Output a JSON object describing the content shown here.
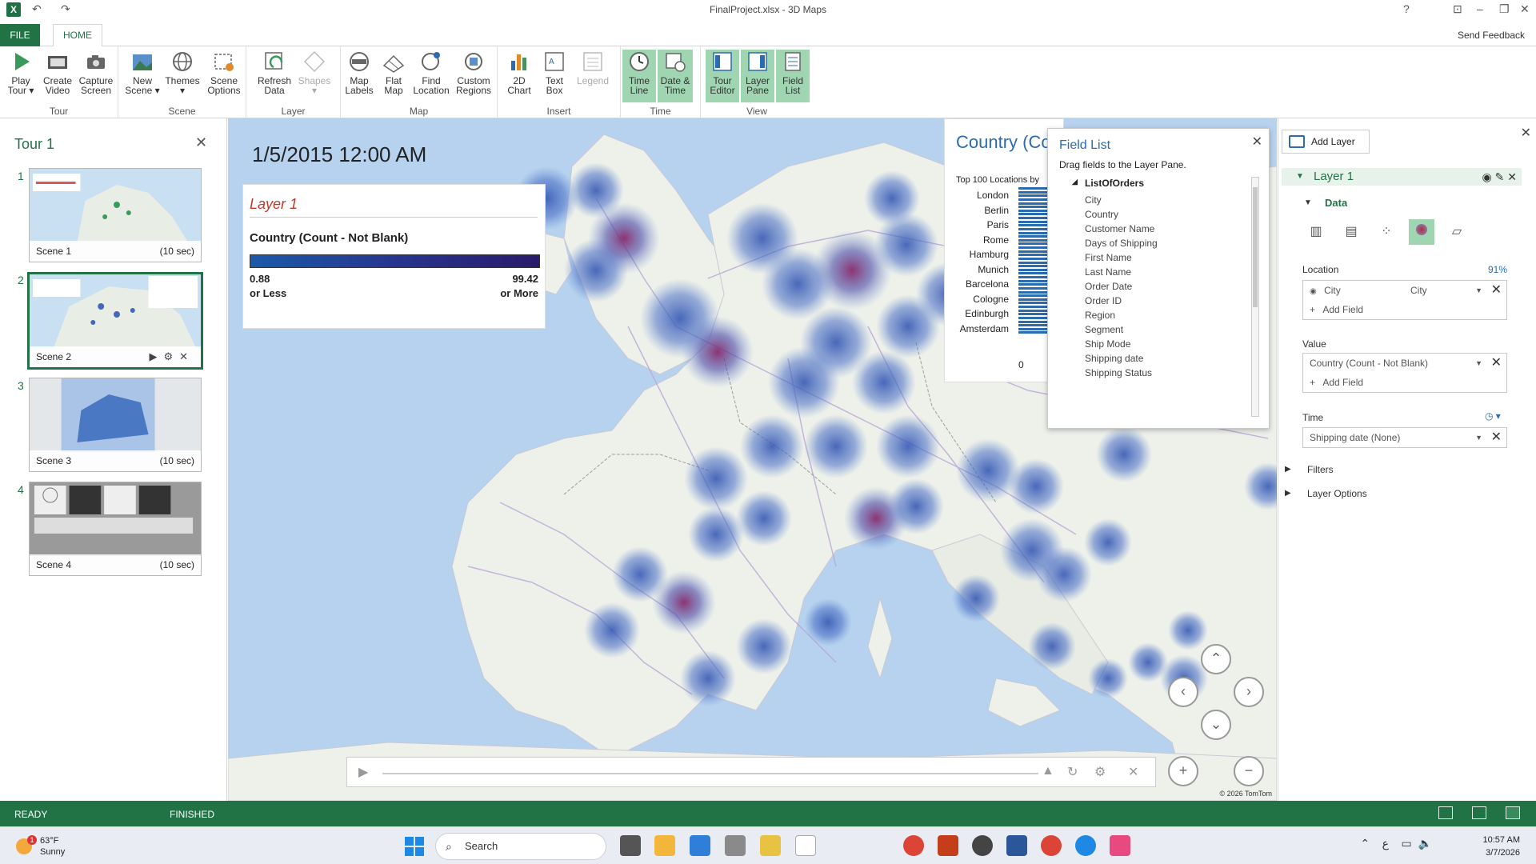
{
  "window": {
    "title": "FinalProject.xlsx - 3D Maps"
  },
  "tabs": {
    "file": "FILE",
    "home": "HOME",
    "send_feedback": "Send Feedback"
  },
  "ribbon": {
    "groups": [
      {
        "label": "Tour",
        "buttons": [
          "Play Tour",
          "Create Video",
          "Capture Screen"
        ]
      },
      {
        "label": "Scene",
        "buttons": [
          "New Scene",
          "Themes",
          "Scene Options"
        ]
      },
      {
        "label": "Layer",
        "buttons": [
          "Refresh Data",
          "Shapes"
        ]
      },
      {
        "label": "Map",
        "buttons": [
          "Map Labels",
          "Flat Map",
          "Find Location",
          "Custom Regions"
        ]
      },
      {
        "label": "Insert",
        "buttons": [
          "2D Chart",
          "Text Box",
          "Legend"
        ]
      },
      {
        "label": "Time",
        "buttons": [
          "Time Line",
          "Date & Time"
        ]
      },
      {
        "label": "View",
        "buttons": [
          "Tour Editor",
          "Layer Pane",
          "Field List"
        ]
      }
    ],
    "b": {
      "play_tour": [
        "Play",
        "Tour ▾"
      ],
      "create_video": [
        "Create",
        "Video"
      ],
      "capture_screen": [
        "Capture",
        "Screen"
      ],
      "new_scene": [
        "New",
        "Scene ▾"
      ],
      "themes": [
        "Themes",
        "▾"
      ],
      "scene_options": [
        "Scene",
        "Options"
      ],
      "refresh_data": [
        "Refresh",
        "Data"
      ],
      "shapes": [
        "Shapes",
        "▾"
      ],
      "map_labels": [
        "Map",
        "Labels"
      ],
      "flat_map": [
        "Flat",
        "Map"
      ],
      "find_location": [
        "Find",
        "Location"
      ],
      "custom_regions": [
        "Custom",
        "Regions"
      ],
      "chart_2d": [
        "2D",
        "Chart"
      ],
      "text_box": [
        "Text",
        "Box"
      ],
      "legend": [
        "Legend",
        ""
      ],
      "time_line": [
        "Time",
        "Line"
      ],
      "date_time": [
        "Date &",
        "Time"
      ],
      "tour_editor": [
        "Tour",
        "Editor"
      ],
      "layer_pane": [
        "Layer",
        "Pane"
      ],
      "field_list": [
        "Field",
        "List"
      ]
    }
  },
  "tour": {
    "title": "Tour 1",
    "scenes": [
      {
        "num": "1",
        "name": "Scene 1",
        "duration": "(10 sec)"
      },
      {
        "num": "2",
        "name": "Scene 2",
        "duration": ""
      },
      {
        "num": "3",
        "name": "Scene 3",
        "duration": "(10 sec)"
      },
      {
        "num": "4",
        "name": "Scene 4",
        "duration": "(10 sec)"
      }
    ]
  },
  "map": {
    "datetime": "1/5/2015 12:00 AM",
    "copyright": "© 2026 TomTom",
    "legend": {
      "layer": "Layer 1",
      "field": "Country (Count - Not Blank)",
      "min_value": "0.88",
      "min_label": "or Less",
      "max_value": "99.42",
      "max_label": "or More"
    },
    "top_locations": {
      "title": "Country (Co",
      "subtitle": "Top 100 Locations",
      "subtitle_cut": "by",
      "axis_zero": "0"
    }
  },
  "chart_data": {
    "type": "bar",
    "title": "Country (Co",
    "subtitle": "Top 100 Locations",
    "categories": [
      "London",
      "Berlin",
      "Paris",
      "Rome",
      "Hamburg",
      "Munich",
      "Barcelona",
      "Cologne",
      "Edinburgh",
      "Amsterdam"
    ],
    "xlabel": "0"
  },
  "field_list": {
    "title": "Field List",
    "hint": "Drag fields to the Layer Pane.",
    "group": "ListOfOrders",
    "fields": [
      "City",
      "Country",
      "Customer Name",
      "Days of Shipping",
      "First Name",
      "Last Name",
      "Order Date",
      "Order ID",
      "Region",
      "Segment",
      "Ship Mode",
      "Shipping date",
      "Shipping Status"
    ]
  },
  "layer_pane": {
    "add_layer": "Add Layer",
    "layer_name": "Layer 1",
    "data_label": "Data",
    "location_label": "Location",
    "location_pct": "91%",
    "location_field": "City",
    "location_type": "City",
    "add_field": "Add Field",
    "value_label": "Value",
    "value_field": "Country (Count - Not Blank)",
    "time_label": "Time",
    "time_field": "Shipping date (None)",
    "filters": "Filters",
    "layer_options": "Layer Options"
  },
  "status": {
    "ready": "READY",
    "finished": "FINISHED"
  },
  "taskbar": {
    "temp": "63°F",
    "weather": "Sunny",
    "weather_badge": "1",
    "search": "Search",
    "time": "10:57 AM",
    "date": "3/7/2026",
    "lang": "ع"
  }
}
